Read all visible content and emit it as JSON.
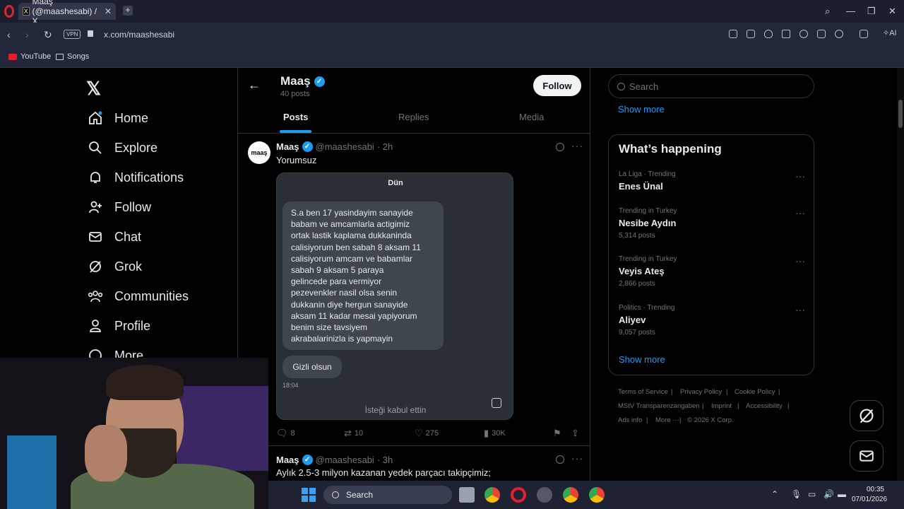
{
  "browser": {
    "tab_title": "Maaş (@maashesabi) / X",
    "url": "x.com/maashesabi",
    "vpn_label": "VPN",
    "ai_label": "AI",
    "bookmarks": [
      "YouTube",
      "Songs"
    ]
  },
  "nav": {
    "items": [
      "Home",
      "Explore",
      "Notifications",
      "Follow",
      "Chat",
      "Grok",
      "Communities",
      "Profile",
      "More"
    ]
  },
  "profile": {
    "name": "Maaş",
    "post_count": "40 posts",
    "follow_label": "Follow",
    "tabs": [
      "Posts",
      "Replies",
      "Media"
    ]
  },
  "tweet1": {
    "avatar_text": "maaş",
    "name": "Maaş",
    "handle": "@maashesabi",
    "time": "· 2h",
    "text": "Yorumsuz",
    "media": {
      "day": "Dün",
      "bubble_lines": [
        "S.a ben 17 yasindayim sanayide",
        "babam ve amcamlarla actigimiz",
        "ortak lastik kaplama dukkaninda",
        "calisiyorum ben sabah 8 aksam 11",
        "calisiyorum amcam ve babamlar",
        "sabah 9 aksam 5 paraya",
        "gelincede para vermiyor",
        "pezevenkler nasil olsa senin",
        "dukkanin diye hergun sanayide",
        "aksam 11 kadar mesai yapiyorum",
        "benim size tavsiyem",
        "akrabalarinizla is yapmayin"
      ],
      "bubble2": "Gizli olsun",
      "time": "18:04",
      "footer": "İsteği kabul ettin"
    },
    "stats": {
      "replies": "8",
      "reposts": "10",
      "likes": "275",
      "views": "30K"
    }
  },
  "tweet2": {
    "name": "Maaş",
    "handle": "@maashesabi",
    "time": "· 3h",
    "text": "Aylık 2.5-3 milyon kazanan yedek parçacı takipçimiz;"
  },
  "right": {
    "search_placeholder": "Search",
    "show_more": "Show more",
    "trending_title": "What’s happening",
    "trends": [
      {
        "meta": "La Liga · Trending",
        "name": "Enes Ünal",
        "count": ""
      },
      {
        "meta": "Trending in Turkey",
        "name": "Nesibe Aydın",
        "count": "5,314 posts"
      },
      {
        "meta": "Trending in Turkey",
        "name": "Veyis Ateş",
        "count": "2,866 posts"
      },
      {
        "meta": "Politics · Trending",
        "name": "Aliyev",
        "count": "9,057 posts"
      }
    ],
    "footer_links": [
      "Terms of Service",
      "Privacy Policy",
      "Cookie Policy",
      "MStV Transparenzangaben",
      "Imprint",
      "Accessibility",
      "Ads info",
      "More ···",
      "© 2026 X Corp."
    ]
  },
  "taskbar": {
    "search_label": "Search",
    "time": "00:35",
    "date": "07/01/2026"
  },
  "colors": {
    "accent": "#1d9bf0",
    "background": "#000000",
    "muted": "#71767b"
  }
}
